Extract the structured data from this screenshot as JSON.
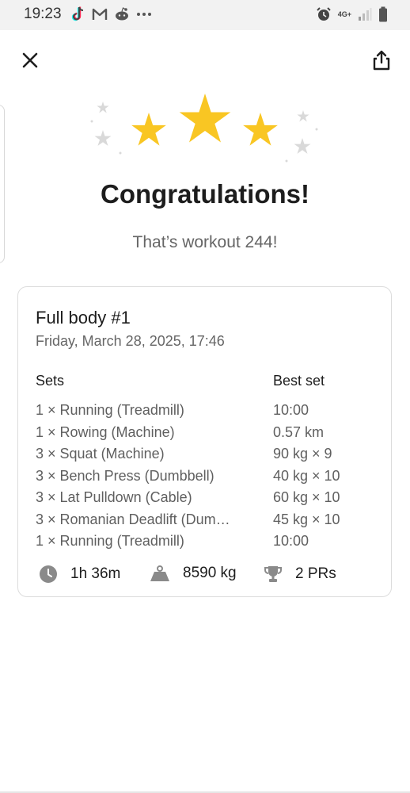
{
  "status_bar": {
    "time": "19:23",
    "network": "4G+",
    "icons": [
      "tiktok-icon",
      "gmail-icon",
      "reddit-icon",
      "more-dots-icon",
      "alarm-icon",
      "signal-icon",
      "battery-icon"
    ]
  },
  "header": {
    "close_icon": "close-icon",
    "share_icon": "share-icon"
  },
  "colors": {
    "star": "#f9c623",
    "sparkle": "#d9d9d9",
    "icon_gray": "#8a8a8a"
  },
  "hero": {
    "title": "Congratulations!",
    "subtitle": "That’s workout 244!"
  },
  "card": {
    "title": "Full body #1",
    "date": "Friday, March 28, 2025, 17:46",
    "sets_header": "Sets",
    "best_header": "Best set",
    "rows": [
      {
        "set": "1 × Running (Treadmill)",
        "best": "10:00"
      },
      {
        "set": "1 × Rowing (Machine)",
        "best": "0.57 km"
      },
      {
        "set": "3 × Squat (Machine)",
        "best": "90 kg × 9"
      },
      {
        "set": "3 × Bench Press (Dumbbell)",
        "best": "40 kg × 10"
      },
      {
        "set": "3 × Lat Pulldown (Cable)",
        "best": "60 kg × 10"
      },
      {
        "set": "3 × Romanian Deadlift (Dum…",
        "best": "45 kg × 10"
      },
      {
        "set": "1 × Running (Treadmill)",
        "best": "10:00"
      }
    ],
    "stats": {
      "duration": "1h 36m",
      "volume": "8590 kg",
      "prs": "2 PRs"
    }
  }
}
